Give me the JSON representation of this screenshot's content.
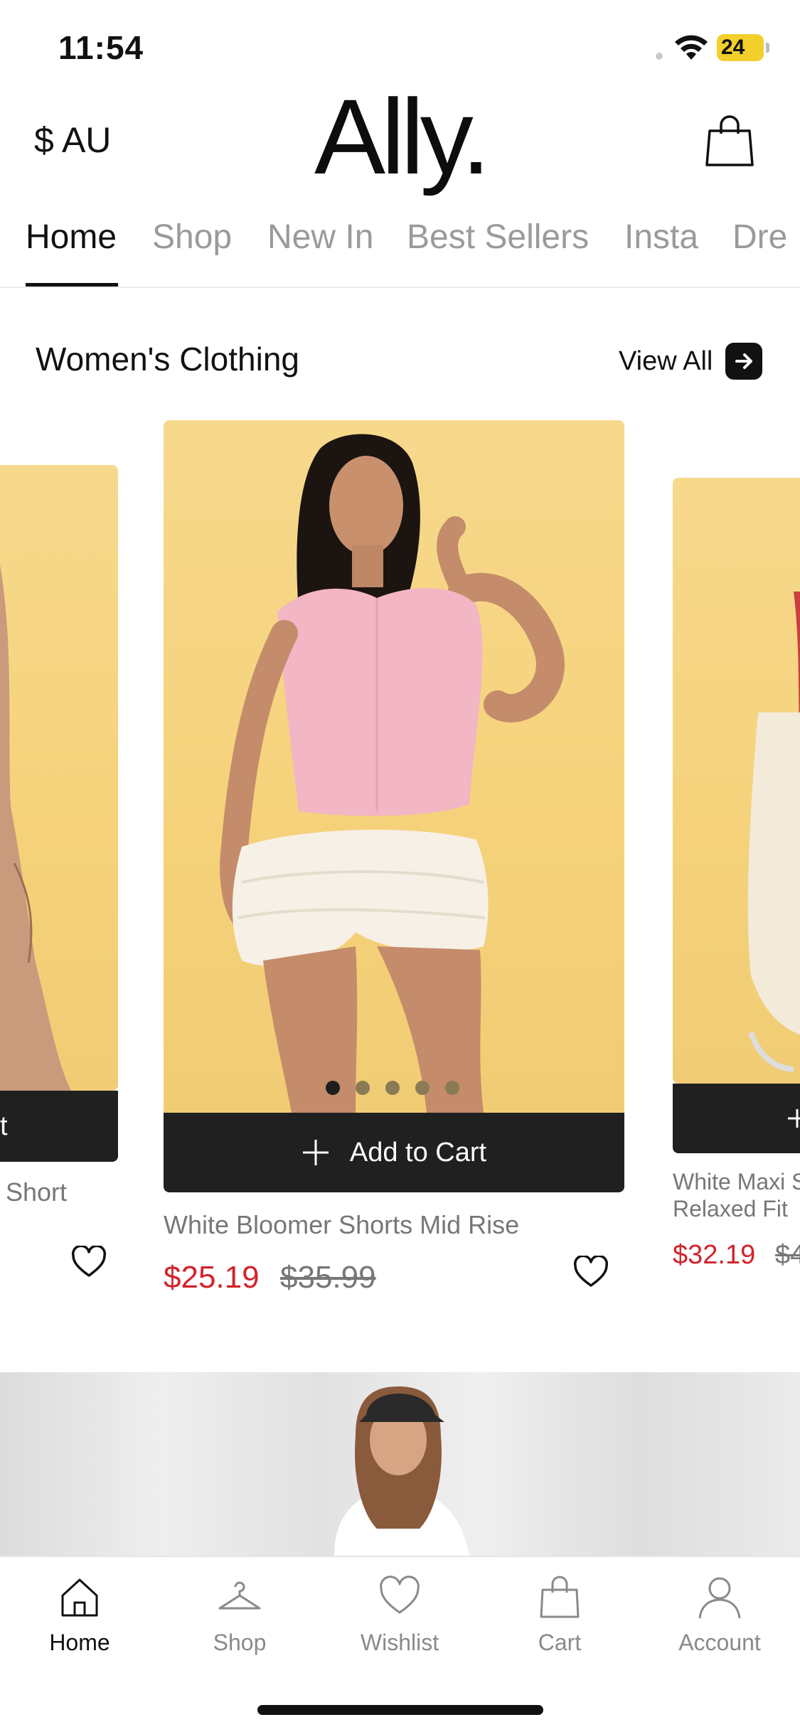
{
  "status_bar": {
    "time": "11:54",
    "battery": "24"
  },
  "header": {
    "currency": "$ AU",
    "logo": "Ally.",
    "bag_icon": "shopping-bag-icon"
  },
  "tabs": [
    {
      "label": "Home",
      "active": true
    },
    {
      "label": "Shop",
      "active": false
    },
    {
      "label": "New In",
      "active": false
    },
    {
      "label": "Best Sellers",
      "active": false
    },
    {
      "label": "Insta",
      "active": false
    },
    {
      "label": "Dre",
      "active": false
    }
  ],
  "section": {
    "title": "Women's Clothing",
    "view_all": "View All"
  },
  "products": {
    "left": {
      "name_fragment": "Short",
      "atc_fragment": "t"
    },
    "center": {
      "name": "White Bloomer Shorts Mid Rise",
      "add_to_cart": "Add to Cart",
      "sale_price": "$25.19",
      "original_price": "$35.99",
      "image_dots": 5,
      "active_dot": 0
    },
    "right": {
      "name_line1": "White Maxi S",
      "name_line2": "Relaxed Fit",
      "sale_price": "$32.19",
      "original_price_fragment": "$4"
    }
  },
  "bottom_nav": [
    {
      "label": "Home",
      "icon": "home-icon",
      "active": true
    },
    {
      "label": "Shop",
      "icon": "hanger-icon",
      "active": false
    },
    {
      "label": "Wishlist",
      "icon": "heart-icon",
      "active": false
    },
    {
      "label": "Cart",
      "icon": "shopping-bag-icon",
      "active": false
    },
    {
      "label": "Account",
      "icon": "user-icon",
      "active": false
    }
  ],
  "colors": {
    "sale": "#d2232a",
    "accent": "#111111",
    "product_bg": "#f5d27a"
  }
}
